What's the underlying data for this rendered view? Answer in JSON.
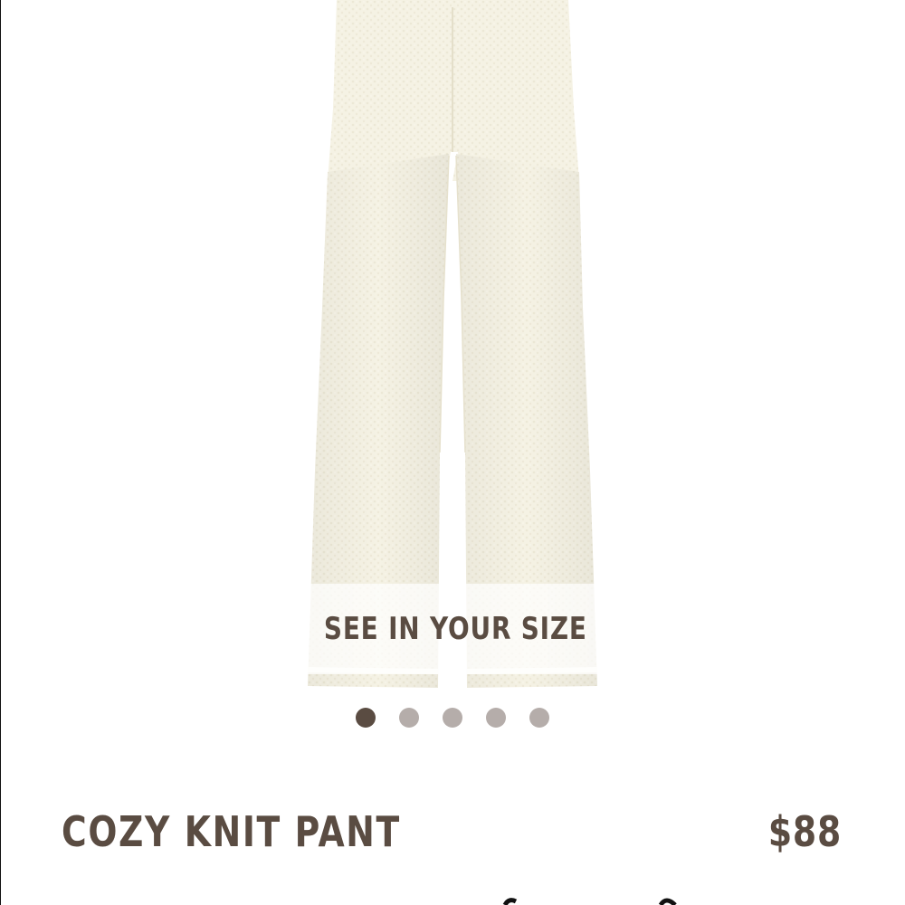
{
  "product": {
    "name": "COZY KNIT PANT",
    "price": "$88",
    "image_alt": "Cream cozy knit wide-leg pant"
  },
  "overlay": {
    "label": "SEE IN YOUR SIZE"
  },
  "carousel": {
    "total": 5,
    "active_index": 0
  },
  "colors": {
    "brand_text": "#5a4c42",
    "dot_inactive": "#b5adaa",
    "fabric": "#f4f1e2"
  }
}
